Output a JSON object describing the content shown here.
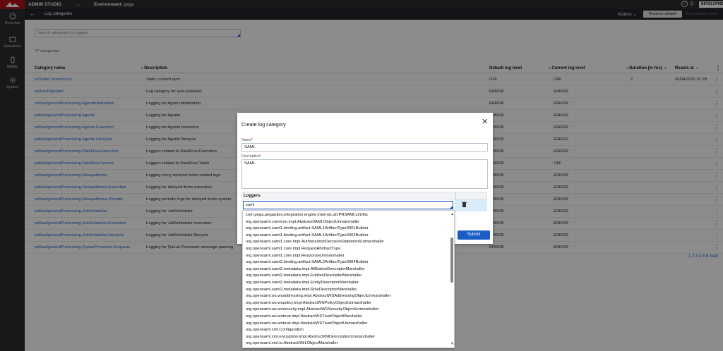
{
  "topbar": {
    "app_name": "ADMIN STUDIO",
    "env_label": "Environment:",
    "env_value": "pega",
    "badge": "DEVELOPMENT"
  },
  "nav": {
    "items": [
      {
        "label": "Overview",
        "icon": "dashboard-icon"
      },
      {
        "label": "Resources",
        "icon": "resources-icon"
      },
      {
        "label": "Mobile",
        "icon": "mobile-icon"
      },
      {
        "label": "System",
        "icon": "gear-icon"
      }
    ]
  },
  "subbar": {
    "title": "Log categories",
    "actions": "Actions",
    "reset_label": "Reset to default",
    "external_label": "External log levels"
  },
  "search": {
    "placeholder": "Search categories by loggers"
  },
  "count": "77 categories",
  "table": {
    "headers": [
      "Category name",
      "Description",
      "Default log level",
      "Current log level",
      "Duration (in hrs)",
      "Resets at"
    ],
    "rows": [
      [
        "pxStaticContentSync",
        "Static content sync",
        "OFF",
        "OFF",
        "2",
        "05/04/2022 07:28"
      ],
      [
        "pxAutoPopulate",
        "Log category for auto populate.",
        "ERROR",
        "ERROR",
        "",
        ""
      ],
      [
        "pxBackgroundProcessing.AgentInitialization",
        "Logging for Agent Initialization",
        "ERROR",
        "ERROR",
        "",
        ""
      ],
      [
        "pxBackgroundProcessing.Agents",
        "Logging for Agents",
        "ERROR",
        "ERROR",
        "",
        ""
      ],
      [
        "pxBackgroundProcessing.Agents.Execution",
        "Logging for Agents execution",
        "ERROR",
        "ERROR",
        "",
        ""
      ],
      [
        "pxBackgroundProcessing.Agents.Lifecycle",
        "Logging for Agents lifecycle",
        "ERROR",
        "ERROR",
        "",
        ""
      ],
      [
        "pxBackgroundProcessing.DataFlow.Execution",
        "Loggers related to DataFlow Execution",
        "ERROR",
        "ERROR",
        "",
        ""
      ],
      [
        "pxBackgroundProcessing.DataFlow.Service",
        "Loggers related to DataFlow Tasks",
        "ERROR",
        "OFF",
        "",
        ""
      ],
      [
        "pxBackgroundProcessing.DelayedItems",
        "Logging every delayed items related logs",
        "ERROR",
        "ERROR",
        "",
        ""
      ],
      [
        "pxBackgroundProcessing.DelayedItems.Execution",
        "Logging for delayed items execution",
        "ERROR",
        "ERROR",
        "",
        ""
      ],
      [
        "pxBackgroundProcessing.DelayedItems.Periodic",
        "Logging periodic logs for delayed items system",
        "ERROR",
        "ERROR",
        "",
        ""
      ],
      [
        "pxBackgroundProcessing.JobScheduler",
        "Logging for JobScheduler",
        "ERROR",
        "ERROR",
        "",
        ""
      ],
      [
        "pxBackgroundProcessing.JobScheduler.Execution",
        "Logging for JobScheduler execution",
        "ERROR",
        "ERROR",
        "",
        ""
      ],
      [
        "pxBackgroundProcessing.JobScheduler.Lifecycle",
        "Logging for JobScheduler lifecycle",
        "ERROR",
        "ERROR",
        "",
        ""
      ],
      [
        "pxBackgroundProcessing.QueueProcessor.Enqueue",
        "Logging for Queue Processor message queuing",
        "ERROR",
        "ERROR",
        "",
        ""
      ]
    ]
  },
  "pagination": "1 2 3 4 5 6 Next",
  "modal": {
    "title": "Create log category",
    "name_label": "Name",
    "name_value": "SAML",
    "desc_label": "Description",
    "desc_value": "SAML",
    "loggers_header": "Loggers",
    "logger_input": "saml",
    "submit_label": "Submit"
  },
  "dropdown": {
    "options": [
      "com.pega.pegarules.integration.engine.internal.util.PRSAMLv2Utils",
      "org.opensaml.common.impl.AbstractSAMLObjectUnmarshaller",
      "org.opensaml.saml1.binding.artifact.SAML1ArtifactType0001Builder",
      "org.opensaml.saml1.binding.artifact.SAML1ArtifactType0002Builder",
      "org.opensaml.saml1.core.impl.AuthorizationDecisionStatementUnmarshaller",
      "org.opensaml.saml1.core.impl.RequestAbstractType",
      "org.opensaml.saml1.core.impl.ResponseUnmarshaller",
      "org.opensaml.saml2.binding.artifact.SAML2ArtifactType0004Builder",
      "org.opensaml.saml2.metadata.impl.AffiliationDescriptorMarshaller",
      "org.opensaml.saml2.metadata.impl.EntitiesDescriptorMarshaller",
      "org.opensaml.saml2.metadata.impl.EntityDescriptorMarshaller",
      "org.opensaml.saml2.metadata.impl.RoleDescriptorMarshaller",
      "org.opensaml.ws.wsaddressing.impl.AbstractWSAddressingObjectUnmarshaller",
      "org.opensaml.ws.wspolicy.impl.AbstractWSPolicyObjectUnmarshaller",
      "org.opensaml.ws.wssecurity.impl.AbstractWSSecurityObjectUnmarshaller",
      "org.opensaml.ws.wstrust.impl.AbstractWSTrustObjectMarshaller",
      "org.opensaml.ws.wstrust.impl.AbstractWSTrustObjectUnmarshaller",
      "org.opensaml.xml.Configuration",
      "org.opensaml.xml.encryption.impl.AbstractXMLEncryptionUnmarshaller",
      "org.opensaml.xml.io.AbstractXMLObjectMarshaller"
    ]
  }
}
